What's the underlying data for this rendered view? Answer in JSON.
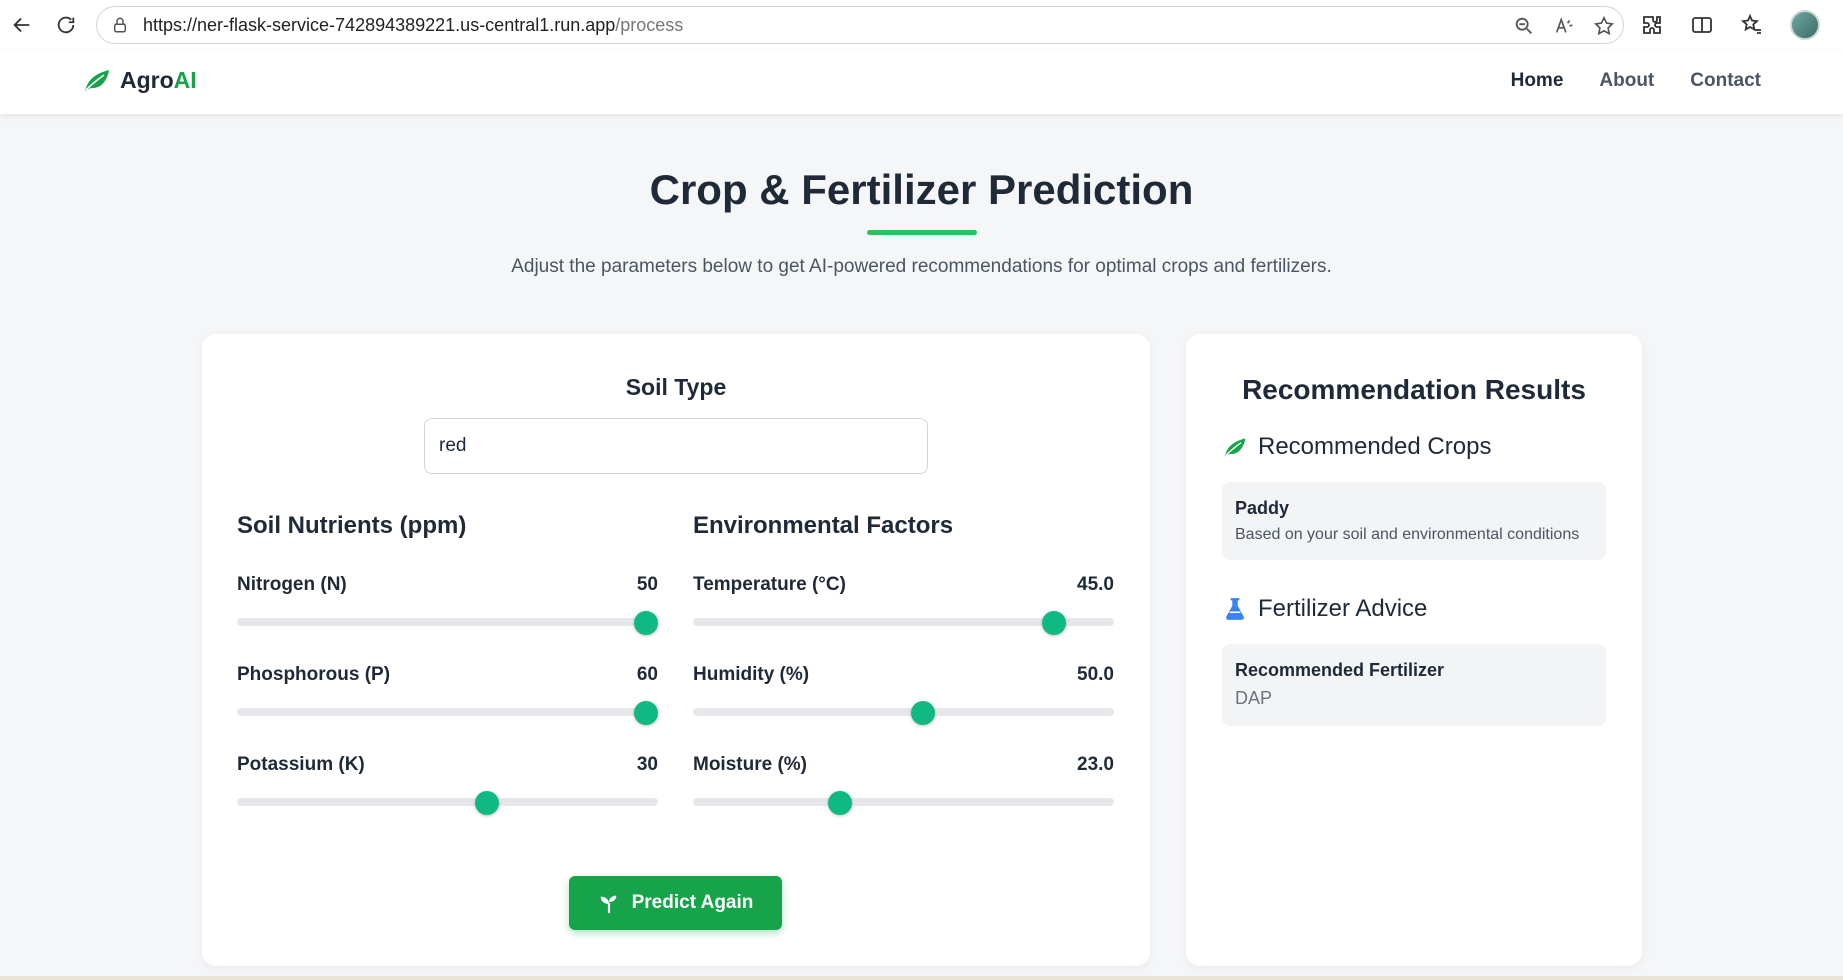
{
  "browser": {
    "url_host": "https://ner-flask-service-742894389221.us-central1.run.app",
    "url_path": "/process"
  },
  "nav": {
    "brand_main": "Agro",
    "brand_accent": "AI",
    "links": [
      "Home",
      "About",
      "Contact"
    ]
  },
  "hero": {
    "title": "Crop & Fertilizer Prediction",
    "subtitle": "Adjust the parameters below to get AI-powered recommendations for optimal crops and fertilizers."
  },
  "form": {
    "soil_type_label": "Soil Type",
    "soil_type_value": "red",
    "nutrients_title": "Soil Nutrients (ppm)",
    "environment_title": "Environmental Factors",
    "nutrients": [
      {
        "label": "Nitrogen (N)",
        "value": "50",
        "level": 1.0
      },
      {
        "label": "Phosphorous (P)",
        "value": "60",
        "level": 1.0
      },
      {
        "label": "Potassium (K)",
        "value": "30",
        "level": 0.6
      }
    ],
    "environment": [
      {
        "label": "Temperature (°C)",
        "value": "45.0",
        "level": 0.88
      },
      {
        "label": "Humidity (%)",
        "value": "50.0",
        "level": 0.55
      },
      {
        "label": "Moisture (%)",
        "value": "23.0",
        "level": 0.34
      }
    ],
    "predict_label": "Predict Again"
  },
  "results": {
    "title": "Recommendation Results",
    "crops_title": "Recommended Crops",
    "crop_name": "Paddy",
    "crop_note": "Based on your soil and environmental conditions",
    "fertilizer_title": "Fertilizer Advice",
    "fertilizer_label": "Recommended Fertilizer",
    "fertilizer_value": "DAP"
  },
  "colors": {
    "accent_green": "#16a34a",
    "slider_thumb": "#10b981",
    "underline": "#22c55e",
    "flask_blue": "#3b82f6"
  },
  "icons": {
    "brand": "leaf-icon",
    "crops": "leaf-icon",
    "fertilizer": "flask-icon",
    "predict": "seedling-icon"
  }
}
